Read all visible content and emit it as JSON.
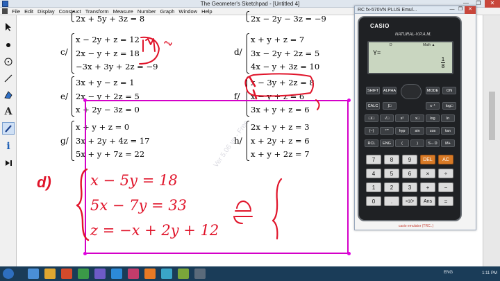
{
  "window": {
    "title": "The Geometer's Sketchpad - [Untitled 4]",
    "min": "—",
    "max": "❐",
    "close": "✕"
  },
  "menu": [
    "File",
    "Edit",
    "Display",
    "Construct",
    "Transform",
    "Measure",
    "Number",
    "Graph",
    "Window",
    "Help"
  ],
  "tools": [
    "arrow-icon",
    "point-icon",
    "compass-icon",
    "straightedge-icon",
    "polygon-icon",
    "text-icon",
    "marker-icon",
    "info-icon",
    "custom-tool-icon"
  ],
  "problems": {
    "top_left": "2x + 5y + 3z = 8",
    "top_right": "2x − 2y − 3z = −9",
    "c": {
      "label": "c/",
      "lines": [
        "x − 2y + z = 12",
        "2x − y + z = 18",
        "−3x + 3y + 2z = −9"
      ]
    },
    "d": {
      "label": "d/",
      "lines": [
        "x + y + z = 7",
        "3x − 2y + 2z = 5",
        "4x − y + 3z = 10"
      ]
    },
    "e": {
      "label": "e/",
      "lines": [
        "3x + y − z = 1",
        "2x − y + 2z = 5",
        "x + 2y − 3z = 0"
      ]
    },
    "f": {
      "label": "f/",
      "lines": [
        "x − 3y + 2z = 8",
        "x − y + z = 6",
        "3x + y + z = 6"
      ]
    },
    "g": {
      "label": "g/",
      "lines": [
        "x + y + z = 0",
        "3x + 2y + 4z = 17",
        "5x + y + 7z = 22"
      ]
    },
    "h": {
      "label": "h/",
      "lines": [
        "2x + y + z = 3",
        "x + 2y + z = 6",
        "x + y + 2z = 7"
      ]
    }
  },
  "handwriting": {
    "label": "d)",
    "lines": [
      "x − 5y = 18",
      "5x − 7y = 33",
      "z = −x + 2y + 12"
    ],
    "notes_c": [
      "(1)",
      "(2)"
    ],
    "equiv": "⇔"
  },
  "watermark": "Ver 5.06 vn - Free",
  "emulator": {
    "title": "RC fx-570VN PLUS Emul...",
    "brand": "CASIO",
    "model": "NATURAL-V.P.A.M.",
    "display": {
      "expr": "Y=",
      "indicator_d": "D",
      "indicator_math": "Math ▲",
      "frac_num": "1",
      "frac_den": "8"
    },
    "caption": "casio emulator (TRC..)",
    "keys_func": [
      "SHIFT",
      "ALPHA",
      "MODE",
      "ON"
    ],
    "keys_row1": [
      "CALC",
      "∫□",
      "x⁻¹",
      "log□"
    ],
    "keys_row2": [
      "□/□",
      "√□",
      "x²",
      "x□",
      "log",
      "ln"
    ],
    "keys_row3": [
      "(−)",
      "°'\"",
      "hyp",
      "sin",
      "cos",
      "tan"
    ],
    "keys_row4": [
      "RCL",
      "ENG",
      "(",
      ")",
      "S⇔D",
      "M+"
    ],
    "keys_row5": [
      "7",
      "8",
      "9",
      "DEL",
      "AC"
    ],
    "keys_row6": [
      "4",
      "5",
      "6",
      "×",
      "÷"
    ],
    "keys_row7": [
      "1",
      "2",
      "3",
      "+",
      "−"
    ],
    "keys_row8": [
      "0",
      ".",
      "×10ˣ",
      "Ans",
      "="
    ]
  },
  "taskbar": {
    "lang": "ENG",
    "time": "1:11 PM"
  },
  "colors": {
    "magenta": "#d400c8",
    "ink_red": "#e0142a",
    "accent_orange": "#d87a26"
  }
}
